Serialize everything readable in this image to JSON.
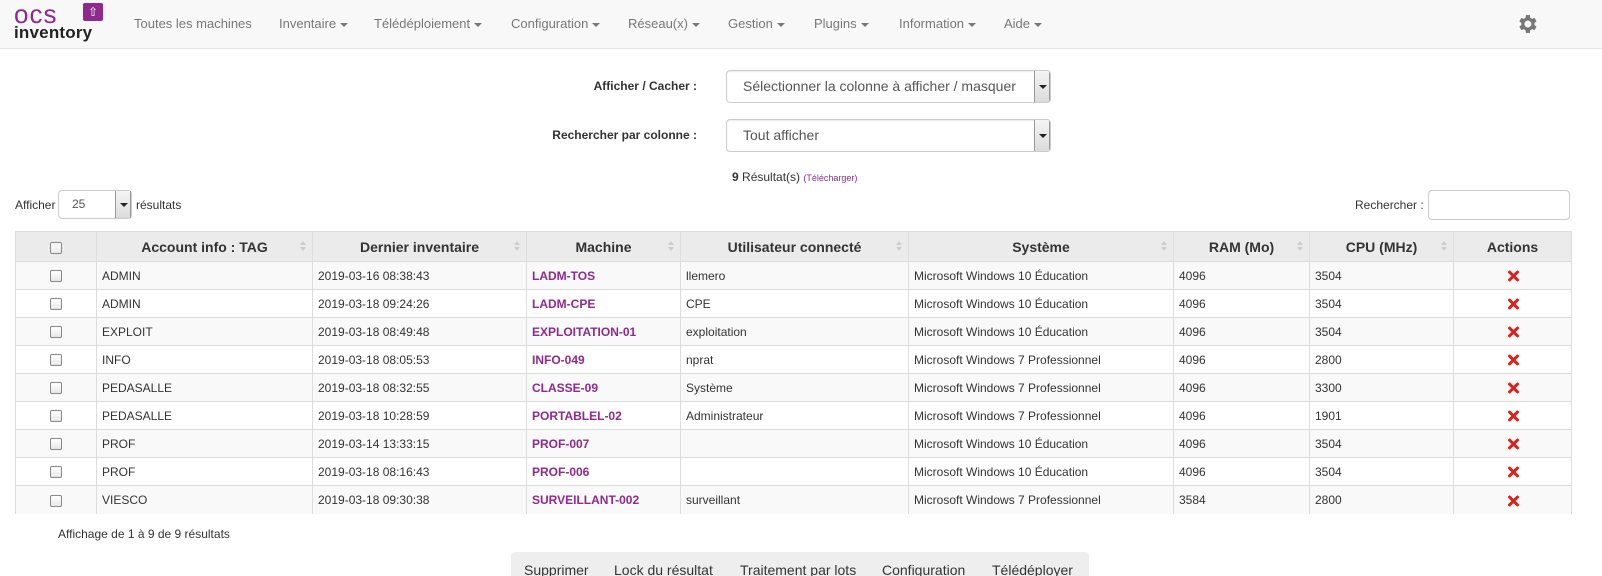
{
  "brand": {
    "logo_top": "ocs",
    "logo_bottom": "inventory",
    "accent": "#8e2a8e"
  },
  "nav": {
    "items": [
      {
        "label": "Toutes les machines",
        "dropdown": false
      },
      {
        "label": "Inventaire",
        "dropdown": true
      },
      {
        "label": "Télédéploiement",
        "dropdown": true
      },
      {
        "label": "Configuration",
        "dropdown": true
      },
      {
        "label": "Réseau(x)",
        "dropdown": true
      },
      {
        "label": "Gestion",
        "dropdown": true
      },
      {
        "label": "Plugins",
        "dropdown": true
      },
      {
        "label": "Information",
        "dropdown": true
      },
      {
        "label": "Aide",
        "dropdown": true
      }
    ],
    "settings_icon": "gear-icon"
  },
  "filters": {
    "show_hide_label": "Afficher / Cacher :",
    "show_hide_value": "Sélectionner la colonne à afficher / masquer",
    "search_by_label": "Rechercher par colonne :",
    "search_by_value": "Tout afficher"
  },
  "results": {
    "count": "9",
    "label": "Résultat(s)",
    "download": "(Télécharger)"
  },
  "pagination": {
    "show_label": "Afficher",
    "page_size": "25",
    "results_label": "résultats",
    "search_label": "Rechercher :",
    "search_value": ""
  },
  "table": {
    "columns": [
      "Account info : TAG",
      "Dernier inventaire",
      "Machine",
      "Utilisateur connecté",
      "Système",
      "RAM (Mo)",
      "CPU (MHz)",
      "Actions"
    ],
    "rows": [
      {
        "tag": "ADMIN",
        "date": "2019-03-16 08:38:43",
        "machine": "LADM-TOS",
        "user": "llemero",
        "system": "Microsoft Windows 10 Éducation",
        "ram": "4096",
        "cpu": "3504"
      },
      {
        "tag": "ADMIN",
        "date": "2019-03-18 09:24:26",
        "machine": "LADM-CPE",
        "user": "CPE",
        "system": "Microsoft Windows 10 Éducation",
        "ram": "4096",
        "cpu": "3504"
      },
      {
        "tag": "EXPLOIT",
        "date": "2019-03-18 08:49:48",
        "machine": "EXPLOITATION-01",
        "user": "exploitation",
        "system": "Microsoft Windows 10 Éducation",
        "ram": "4096",
        "cpu": "3504"
      },
      {
        "tag": "INFO",
        "date": "2019-03-18 08:05:53",
        "machine": "INFO-049",
        "user": "nprat",
        "system": "Microsoft Windows 7 Professionnel",
        "ram": "4096",
        "cpu": "2800"
      },
      {
        "tag": "PEDASALLE",
        "date": "2019-03-18 08:32:55",
        "machine": "CLASSE-09",
        "user": "Système",
        "system": "Microsoft Windows 7 Professionnel",
        "ram": "4096",
        "cpu": "3300"
      },
      {
        "tag": "PEDASALLE",
        "date": "2019-03-18 10:28:59",
        "machine": "PORTABLEL-02",
        "user": "Administrateur",
        "system": "Microsoft Windows 7 Professionnel",
        "ram": "4096",
        "cpu": "1901"
      },
      {
        "tag": "PROF",
        "date": "2019-03-14 13:33:15",
        "machine": "PROF-007",
        "user": "",
        "system": "Microsoft Windows 10 Éducation",
        "ram": "4096",
        "cpu": "3504"
      },
      {
        "tag": "PROF",
        "date": "2019-03-18 08:16:43",
        "machine": "PROF-006",
        "user": "",
        "system": "Microsoft Windows 10 Éducation",
        "ram": "4096",
        "cpu": "3504"
      },
      {
        "tag": "VIESCO",
        "date": "2019-03-18 09:30:38",
        "machine": "SURVEILLANT-002",
        "user": "surveillant",
        "system": "Microsoft Windows 7 Professionnel",
        "ram": "3584",
        "cpu": "2800"
      }
    ]
  },
  "footer": {
    "info": "Affichage de 1 à 9 de 9 résultats"
  },
  "actions": [
    "Supprimer",
    "Lock du résultat",
    "Traitement par lots",
    "Configuration",
    "Télédéployer"
  ]
}
